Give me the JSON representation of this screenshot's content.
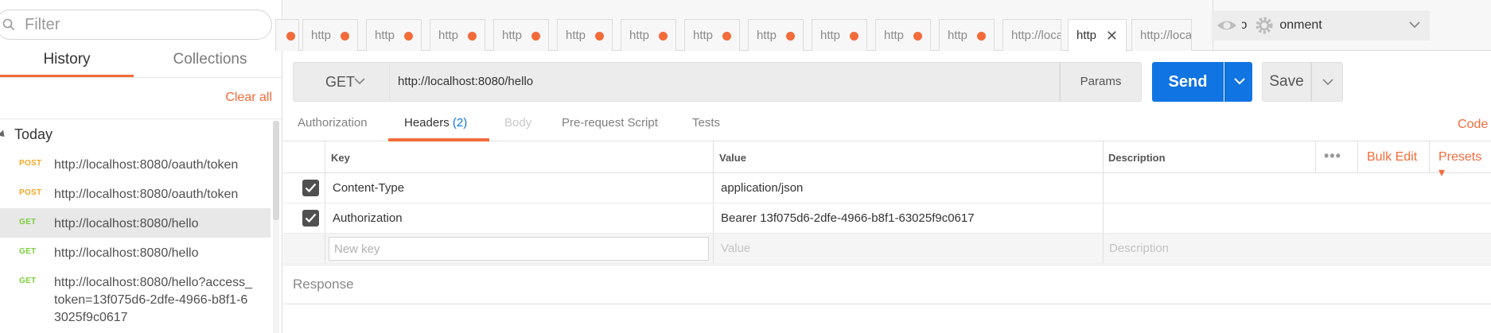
{
  "sidebar": {
    "filter_placeholder": "Filter",
    "tabs": [
      "History",
      "Collections"
    ],
    "active_tab": "History",
    "clear_all": "Clear all",
    "group_label": "Today",
    "history": [
      {
        "method": "POST",
        "url": "http://localhost:8080/oauth/token"
      },
      {
        "method": "POST",
        "url": "http://localhost:8080/oauth/token"
      },
      {
        "method": "GET",
        "url": "http://localhost:8080/hello",
        "selected": true
      },
      {
        "method": "GET",
        "url": "http://localhost:8080/hello"
      },
      {
        "method": "GET",
        "url": "http://localhost:8080/hello?access_token=13f075d6-2dfe-4966-b8f1-63025f9c0617",
        "url_lines": [
          "http://localhost:8080/hello?access_",
          "token=13f075d6-2dfe-4966-b8f1-6",
          "3025f9c0617"
        ]
      }
    ]
  },
  "tabs": {
    "items": [
      {
        "label": "http",
        "unsaved": true
      },
      {
        "label": "http",
        "unsaved": true
      },
      {
        "label": "http",
        "unsaved": true
      },
      {
        "label": "http",
        "unsaved": true
      },
      {
        "label": "http",
        "unsaved": true
      },
      {
        "label": "http",
        "unsaved": true
      },
      {
        "label": "http",
        "unsaved": true
      },
      {
        "label": "http",
        "unsaved": true
      },
      {
        "label": "http",
        "unsaved": true
      },
      {
        "label": "http",
        "unsaved": true
      },
      {
        "label": "http",
        "unsaved": true
      },
      {
        "label": "http://loca",
        "unsaved": false
      },
      {
        "label": "http",
        "active": true
      },
      {
        "label": "http://loca",
        "unsaved": false
      }
    ]
  },
  "environment": {
    "selected": "No Environment"
  },
  "request": {
    "method": "GET",
    "url": "http://localhost:8080/hello",
    "params_label": "Params",
    "send_label": "Send",
    "save_label": "Save"
  },
  "section_tabs": {
    "authorization": "Authorization",
    "headers": "Headers",
    "headers_count": "(2)",
    "body": "Body",
    "prerequest": "Pre-request Script",
    "tests": "Tests",
    "code": "Code"
  },
  "headers_table": {
    "columns": {
      "key": "Key",
      "value": "Value",
      "description": "Description"
    },
    "bulk_edit": "Bulk Edit",
    "presets": "Presets",
    "more": "•••",
    "rows": [
      {
        "checked": true,
        "key": "Content-Type",
        "value": "application/json",
        "description": ""
      },
      {
        "checked": true,
        "key": "Authorization",
        "value": "Bearer 13f075d6-2dfe-4966-b8f1-63025f9c0617",
        "description": ""
      }
    ],
    "new_key_placeholder": "New key",
    "new_value_placeholder": "Value",
    "new_description_placeholder": "Description"
  },
  "response": {
    "label": "Response"
  },
  "colors": {
    "accent": "#f26b3a",
    "send": "#1074e2",
    "post": "#f5a623",
    "get": "#7ccf3b"
  }
}
